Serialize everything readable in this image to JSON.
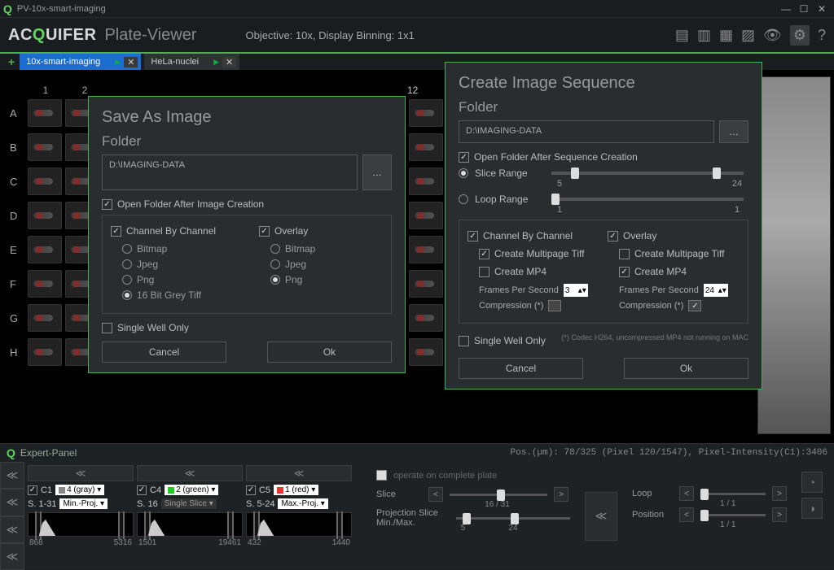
{
  "window": {
    "title": "PV-10x-smart-imaging"
  },
  "header": {
    "logo_prefix": "AC",
    "logo_mid": "Q",
    "logo_suffix": "UIFER",
    "app_name": "Plate-Viewer",
    "objective": "Objective: 10x, Display Binning: 1x1"
  },
  "tabs": [
    {
      "label": "10x-smart-imaging"
    },
    {
      "label": "HeLa-nuclei"
    }
  ],
  "plate": {
    "columns": [
      "1",
      "2",
      "12"
    ],
    "rows": [
      "A",
      "B",
      "C",
      "D",
      "E",
      "F",
      "G",
      "H"
    ],
    "preview_corner": "fit"
  },
  "save_dialog": {
    "title": "Save As Image",
    "folder_label": "Folder",
    "folder_path": "D:\\IMAGING-DATA",
    "open_after": "Open Folder After Image Creation",
    "ch_by_ch": "Channel By Channel",
    "overlay": "Overlay",
    "fmt": {
      "bitmap": "Bitmap",
      "jpeg": "Jpeg",
      "png": "Png",
      "tiff16": "16 Bit Grey Tiff"
    },
    "single_well": "Single Well Only",
    "cancel": "Cancel",
    "ok": "Ok"
  },
  "seq_dialog": {
    "title": "Create Image Sequence",
    "folder_label": "Folder",
    "folder_path": "D:\\IMAGING-DATA",
    "open_after": "Open Folder After Sequence Creation",
    "slice_range": "Slice Range",
    "slice_min": "5",
    "slice_max": "24",
    "loop_range": "Loop Range",
    "loop_min": "1",
    "loop_max": "1",
    "ch_by_ch": "Channel By Channel",
    "overlay": "Overlay",
    "multipage_tiff": "Create Multipage Tiff",
    "create_mp4": "Create MP4",
    "fps_label": "Frames Per Second",
    "fps_left": "3",
    "fps_right": "24",
    "compression": "Compression (*)",
    "single_well": "Single Well Only",
    "footnote": "(*) Codec H264, uncompressed MP4 not running on MAC",
    "cancel": "Cancel",
    "ok": "Ok"
  },
  "expert": {
    "title": "Expert-Panel",
    "status": "Pos.(µm): 78/325 (Pixel 120/1547), Pixel-Intensity(C1):3406",
    "operate_label": "operate on complete plate",
    "channels": [
      {
        "name": "C1",
        "color": "4 (gray)",
        "sw": "gray",
        "slice": "S. 1-31",
        "proj": "Min.-Proj.",
        "hmin": "868",
        "hmax": "5316"
      },
      {
        "name": "C4",
        "color": "2 (green)",
        "sw": "green",
        "slice": "S. 16",
        "proj": "Single Slice",
        "hmin": "1501",
        "hmax": "19461"
      },
      {
        "name": "C5",
        "color": "1 (red)",
        "sw": "red",
        "slice": "S. 5-24",
        "proj": "Max.-Proj.",
        "hmin": "432",
        "hmax": "1440"
      }
    ],
    "slice_label": "Slice",
    "slice_val": "16 / 31",
    "proj_label": "Projection Slice Min./Max.",
    "proj_min": "5",
    "proj_max": "24",
    "loop_label": "Loop",
    "loop_val": "1 / 1",
    "pos_label": "Position",
    "pos_val": "1 / 1"
  }
}
